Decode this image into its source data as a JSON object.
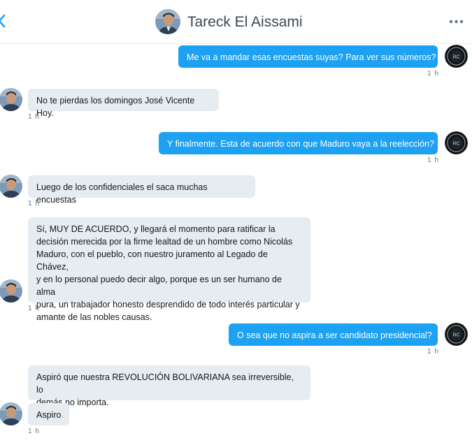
{
  "header": {
    "title": "Tareck El Aissami",
    "back_icon": "chevron-left-icon",
    "more_icon": "more-horizontal-icon"
  },
  "colors": {
    "accent": "#1da1f2",
    "incoming_bubble": "#e6ecf0",
    "timestamp": "#657786"
  },
  "messages": [
    {
      "direction": "out",
      "text": "Me va a mandar esas encuestas suyas? Para ver sus números?",
      "time": "1 h"
    },
    {
      "direction": "in",
      "text": "No te pierdas los domingos José Vicente Hoy.",
      "time": "1 h"
    },
    {
      "direction": "out",
      "text": "Y finalmente. Esta de acuerdo con que Maduro vaya a la reelección?",
      "time": "1 h"
    },
    {
      "direction": "in",
      "text": "Luego de los confidenciales el saca muchas encuestas",
      "time": "1 h"
    },
    {
      "direction": "in",
      "text": "Sí, MUY DE ACUERDO, y llegará el momento para ratificar la\ndecisión merecida por la firme lealtad de un hombre como Nicolás\nMaduro, con el pueblo, con nuestro juramento al Legado de Chávez,\ny en lo personal puedo decir algo, porque es un ser humano de alma\npura, un trabajador honesto desprendido de todo interés particular y\namante de las nobles causas.",
      "time": "1 h"
    },
    {
      "direction": "out",
      "text": "O sea que no aspira a ser candidato presidencial?",
      "time": "1 h"
    },
    {
      "direction": "in",
      "text": "Aspiró que nuestra REVOLUCIÓN BOLIVARIANA sea irreversible, lo\ndemás no importa.",
      "time": ""
    },
    {
      "direction": "in",
      "text": "Aspiro",
      "time": "1 h"
    }
  ],
  "avatars": {
    "out_badge": "RC"
  }
}
